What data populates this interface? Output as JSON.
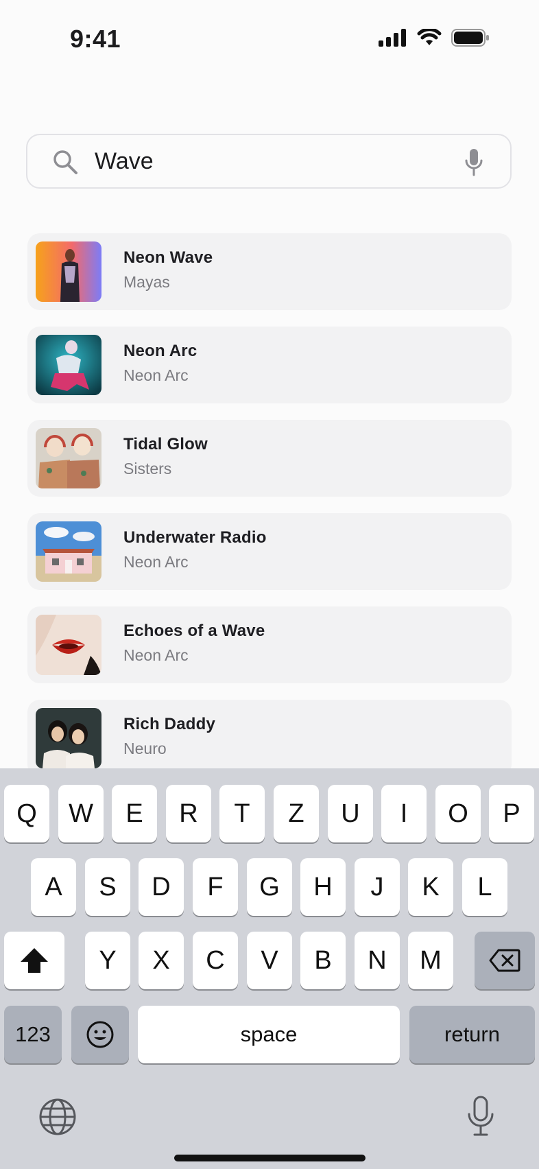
{
  "status": {
    "time": "9:41"
  },
  "search": {
    "value": "Wave",
    "placeholder": ""
  },
  "results": [
    {
      "title": "Neon Wave",
      "artist": "Mayas",
      "art": "art-orange-portrait"
    },
    {
      "title": "Neon Arc",
      "artist": "Neon Arc",
      "art": "art-teal-dancer"
    },
    {
      "title": "Tidal Glow",
      "artist": "Sisters",
      "art": "art-headphones-duo"
    },
    {
      "title": "Underwater Radio",
      "artist": "Neon Arc",
      "art": "art-pink-house"
    },
    {
      "title": "Echoes of a Wave",
      "artist": "Neon Arc",
      "art": "art-red-lips"
    },
    {
      "title": "Rich Daddy",
      "artist": "Neuro",
      "art": "art-dark-duo"
    }
  ],
  "keyboard": {
    "row1": [
      "Q",
      "W",
      "E",
      "R",
      "T",
      "Z",
      "U",
      "I",
      "O",
      "P"
    ],
    "row2": [
      "A",
      "S",
      "D",
      "F",
      "G",
      "H",
      "J",
      "K",
      "L"
    ],
    "row3": [
      "Y",
      "X",
      "C",
      "V",
      "B",
      "N",
      "M"
    ],
    "numbers_label": "123",
    "space_label": "space",
    "return_label": "return"
  },
  "colors": {
    "background": "#fbfbfb",
    "row": "#f2f2f3",
    "keyboard": "#d1d3d9"
  }
}
